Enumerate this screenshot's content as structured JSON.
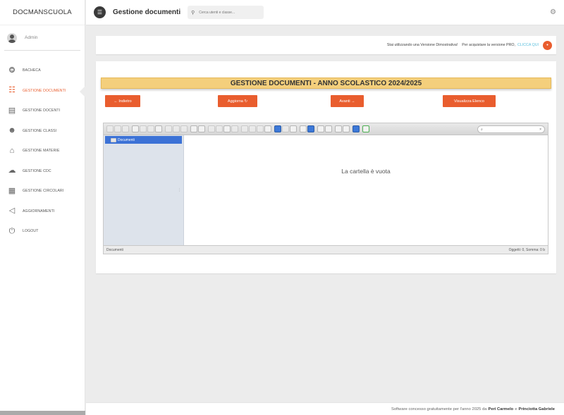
{
  "sidebar": {
    "brand": "DOCMANSCUOLA",
    "user": "Admin",
    "items": [
      {
        "label": "BACHECA",
        "icon": "dashboard-icon",
        "glyph": "⭗",
        "active": false
      },
      {
        "label": "GESTIONE DOCUMENTI",
        "icon": "document-icon",
        "glyph": "☷",
        "active": true
      },
      {
        "label": "GESTIONE DOCENTI",
        "icon": "id-card-icon",
        "glyph": "▤",
        "active": false
      },
      {
        "label": "GESTIONE CLASSI",
        "icon": "users-icon",
        "glyph": "☻",
        "active": false
      },
      {
        "label": "GESTIONE MATERIE",
        "icon": "institution-icon",
        "glyph": "⌂",
        "active": false
      },
      {
        "label": "GESTIONE CDC",
        "icon": "cloud-upload-icon",
        "glyph": "☁",
        "active": false
      },
      {
        "label": "GESTIONE CIRCOLARI",
        "icon": "newspaper-icon",
        "glyph": "▦",
        "active": false
      },
      {
        "label": "AGGIORNAMENTI",
        "icon": "megaphone-icon",
        "glyph": "◁",
        "active": false
      },
      {
        "label": "LOGOUT",
        "icon": "power-icon",
        "glyph": "⏻",
        "active": false
      }
    ]
  },
  "topbar": {
    "title": "Gestione documenti",
    "search_placeholder": "Cerca utenti e classe..."
  },
  "notice": {
    "text": "Stai utilizzando una Versione Dimostrativa!",
    "text2": "Per acquistare la versione PRO,",
    "link": "CLICCA QUI",
    "accent": "#e95d2e"
  },
  "main": {
    "banner": "GESTIONE DOCUMENTI - ANNO SCOLASTICO 2024/2025",
    "buttons": {
      "back": "← Indietro",
      "reload": "Aggiorna ↻",
      "next": "Avanti →",
      "list": "Visualizza Elenco"
    }
  },
  "file_manager": {
    "search_glyph": "⌕",
    "search_clear": "×",
    "tree_root": "Documenti",
    "empty_message": "La cartella è vuota",
    "status_path": "Documenti",
    "status_summary": "Oggetti: 0, Somma: 0 b"
  },
  "footer": {
    "prefix": "Software concesso gratuitamente per l'anno 2025 da",
    "author1": "Peri Carmelo",
    "conj": "e",
    "author2": "Princiotta Gabriele"
  }
}
